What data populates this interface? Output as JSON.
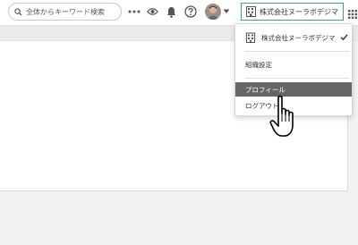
{
  "header": {
    "search": {
      "placeholder": "全体からキーワード検索",
      "icon": "search-icon"
    },
    "icons": [
      "more-horizontal-icon",
      "eye-icon",
      "bell-icon",
      "help-icon",
      "chevron-down-icon",
      "building-icon",
      "apps-grid-icon"
    ],
    "org_button_label": "株式会社ヌーラボデジマ",
    "accent_color": "#3ca96a"
  },
  "dropdown": {
    "org_label": "株式会社ヌーラボデジマ",
    "org_selected": true,
    "items": [
      {
        "label": "組織設定"
      },
      {
        "label": "プロフィール"
      },
      {
        "label": "ログアウト"
      }
    ],
    "highlight_color": "#666666"
  }
}
